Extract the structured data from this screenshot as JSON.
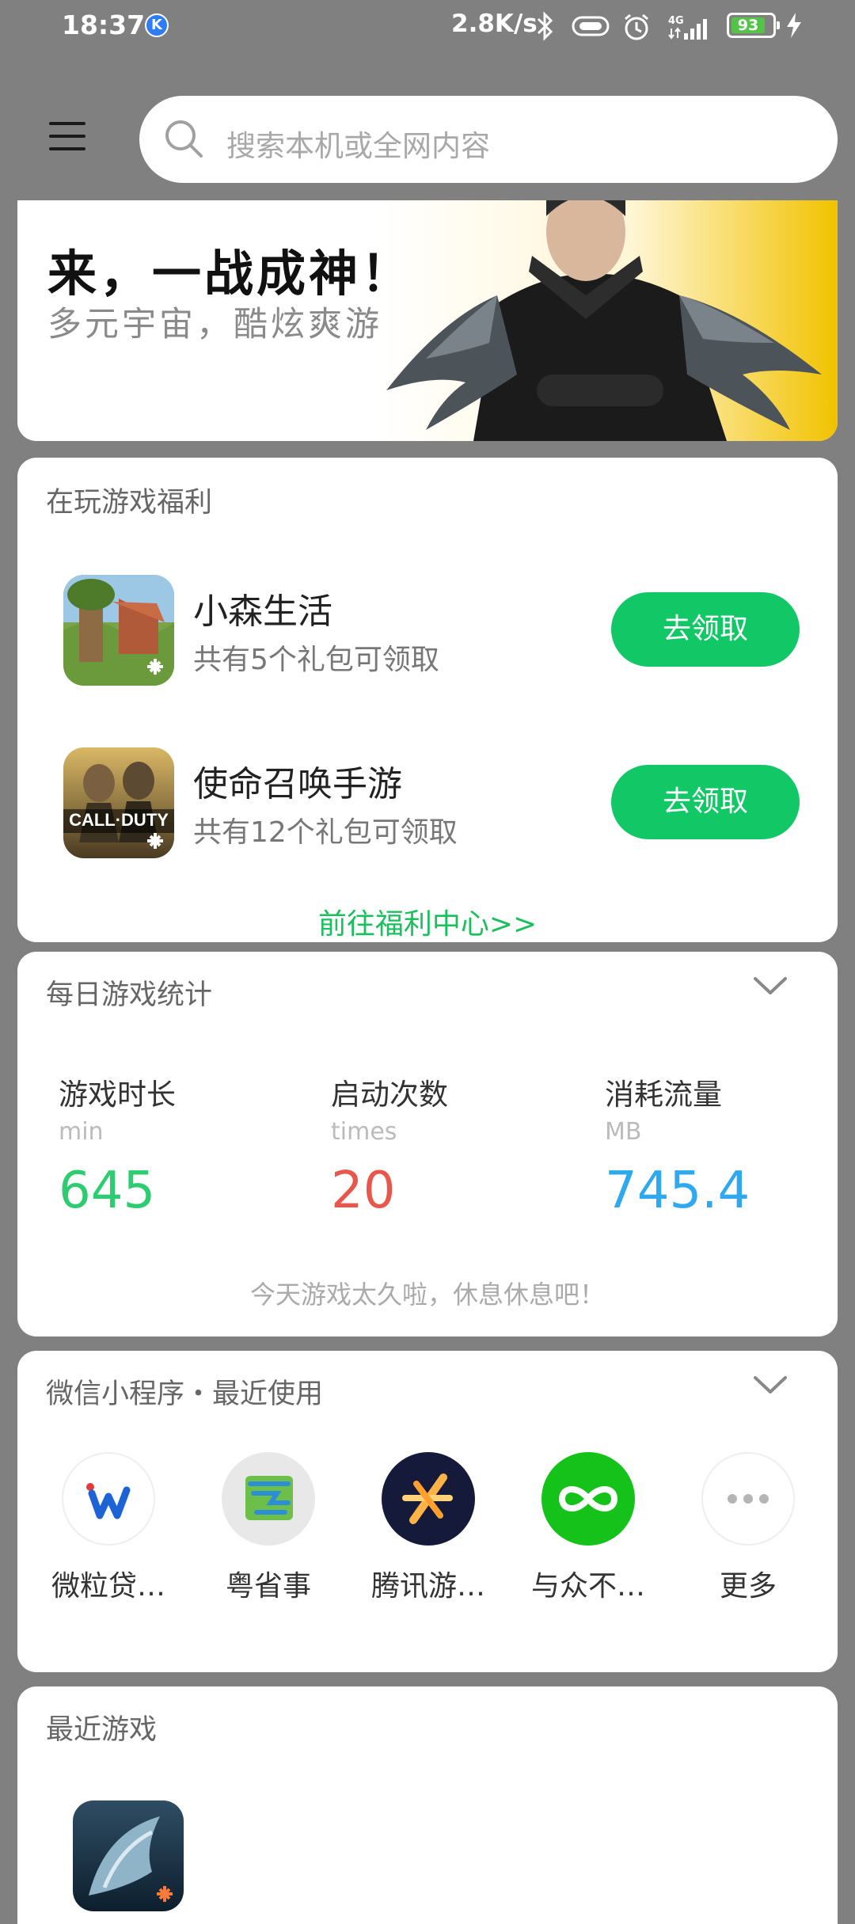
{
  "status_bar": {
    "time": "18:37",
    "k_badge": "K",
    "net_speed": "2.8K/s",
    "signal_label": "4G",
    "battery": "93",
    "icons": [
      "bluetooth-icon",
      "vibrate-icon",
      "alarm-icon",
      "signal-icon",
      "battery-icon",
      "charging-icon"
    ]
  },
  "search": {
    "placeholder": "搜索本机或全网内容"
  },
  "banner": {
    "title": "来，一战成神！",
    "subtitle": "多元宇宙，酷炫爽游"
  },
  "welfare": {
    "title": "在玩游戏福利",
    "games": [
      {
        "name": "小森生活",
        "desc": "共有5个礼包可领取",
        "button": "去领取"
      },
      {
        "name": "使命召唤手游",
        "desc": "共有12个礼包可领取",
        "button": "去领取",
        "icon_text": "CALL·DUTY"
      }
    ],
    "link": "前往福利中心>>"
  },
  "stats": {
    "title": "每日游戏统计",
    "items": [
      {
        "label": "游戏时长",
        "unit": "min",
        "value": "645",
        "color": "#2ecc71"
      },
      {
        "label": "启动次数",
        "unit": "times",
        "value": "20",
        "color": "#e8574b"
      },
      {
        "label": "消耗流量",
        "unit": "MB",
        "value": "745.4",
        "color": "#2fa8ee"
      }
    ],
    "note": "今天游戏太久啦，休息休息吧！"
  },
  "mini_programs": {
    "title": "微信小程序・最近使用",
    "items": [
      {
        "label": "微粒贷…",
        "icon": "weilidai-icon"
      },
      {
        "label": "粤省事",
        "icon": "yueshengshi-icon"
      },
      {
        "label": "腾讯游…",
        "icon": "tencent-games-icon"
      },
      {
        "label": "与众不…",
        "icon": "infinity-icon"
      },
      {
        "label": "更多",
        "icon": "more-icon"
      }
    ]
  },
  "recent_games": {
    "title": "最近游戏"
  }
}
